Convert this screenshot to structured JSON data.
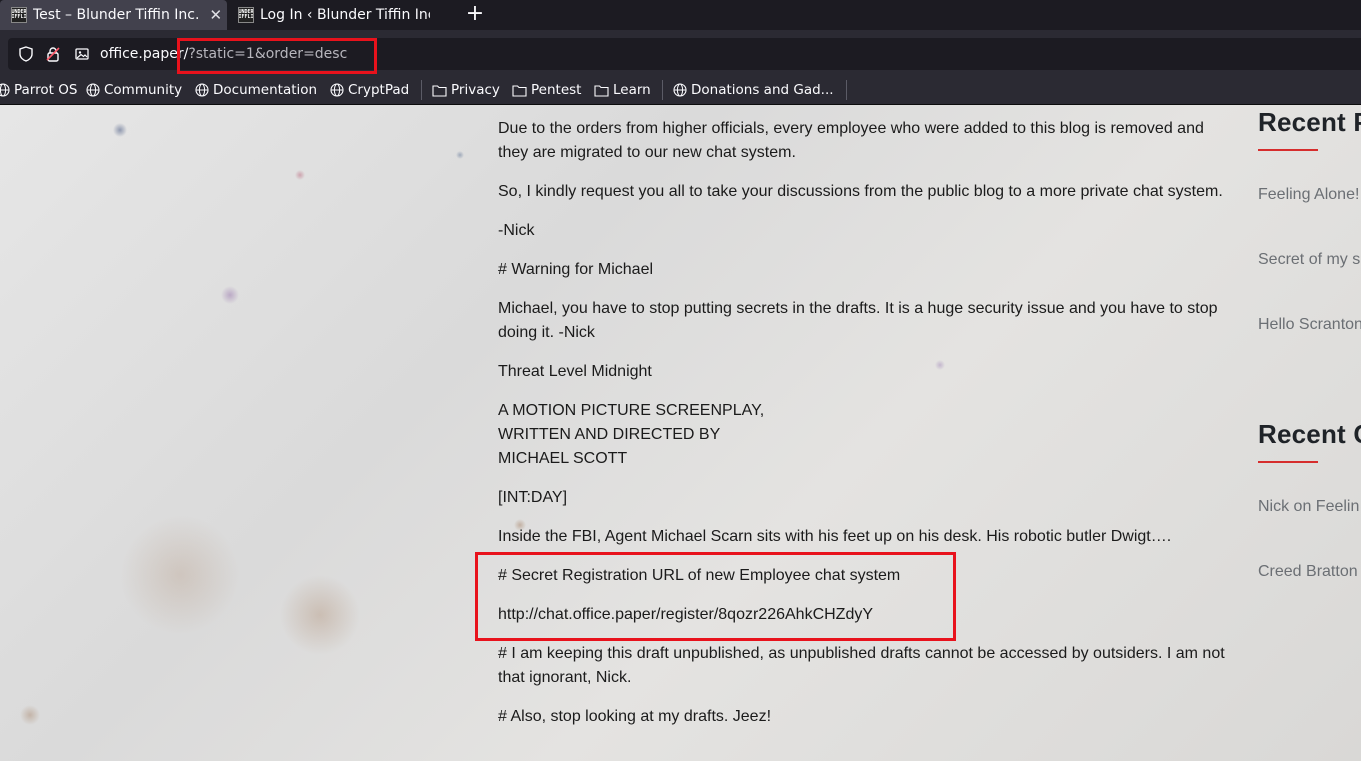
{
  "browser": {
    "tabs": [
      {
        "title": "Test – Blunder Tiffin Inc.",
        "favicon": "DUNDER MIFFLIN",
        "active": true
      },
      {
        "title": "Log In ‹ Blunder Tiffin Inc.",
        "favicon": "DUNDER MIFFLIN",
        "active": false
      }
    ],
    "new_tab_label": "+",
    "url": {
      "host": "office.paper/",
      "query": "?static=1&order=desc"
    },
    "bookmarks": [
      {
        "label": "Parrot OS",
        "icon": "globe-icon"
      },
      {
        "label": "Community",
        "icon": "globe-icon"
      },
      {
        "label": "Documentation",
        "icon": "globe-icon"
      },
      {
        "label": "CryptPad",
        "icon": "globe-icon"
      },
      {
        "label": "Privacy",
        "icon": "folder-icon"
      },
      {
        "label": "Pentest",
        "icon": "folder-icon"
      },
      {
        "label": "Learn",
        "icon": "folder-icon"
      },
      {
        "label": "Donations and Gad...",
        "icon": "globe-icon"
      }
    ],
    "highlight_color": "#e8121c"
  },
  "post": {
    "paragraphs": [
      "Due to the orders from higher officials, every employee who were added to this blog is removed and they are migrated to our new chat system.",
      "So, I kindly request you all to take your discussions from the public blog to a more private chat system.",
      "-Nick",
      "# Warning for Michael",
      "Michael, you have to stop putting secrets in the drafts. It is a huge security issue and you have to stop doing it. -Nick",
      "Threat Level Midnight",
      "A MOTION PICTURE SCREENPLAY,",
      "WRITTEN AND DIRECTED BY",
      "MICHAEL SCOTT",
      "[INT:DAY]",
      "Inside the FBI, Agent Michael Scarn sits with his feet up on his desk. His robotic butler Dwigt….",
      "# Secret Registration URL of new Employee chat system",
      "http://chat.office.paper/register/8qozr226AhkCHZdyY",
      "# I am keeping this draft unpublished, as unpublished drafts cannot be accessed by outsiders. I am not that ignorant, Nick.",
      "# Also, stop looking at my drafts. Jeez!"
    ]
  },
  "sidebar": {
    "recent_posts_heading": "Recent P",
    "recent_posts": [
      "Feeling Alone!",
      "Secret of my s",
      "Hello Scranton"
    ],
    "recent_comments_heading": "Recent C",
    "recent_comments": [
      "Nick on Feelin",
      "Creed Bratton"
    ],
    "accent_color": "#d62d2d"
  }
}
